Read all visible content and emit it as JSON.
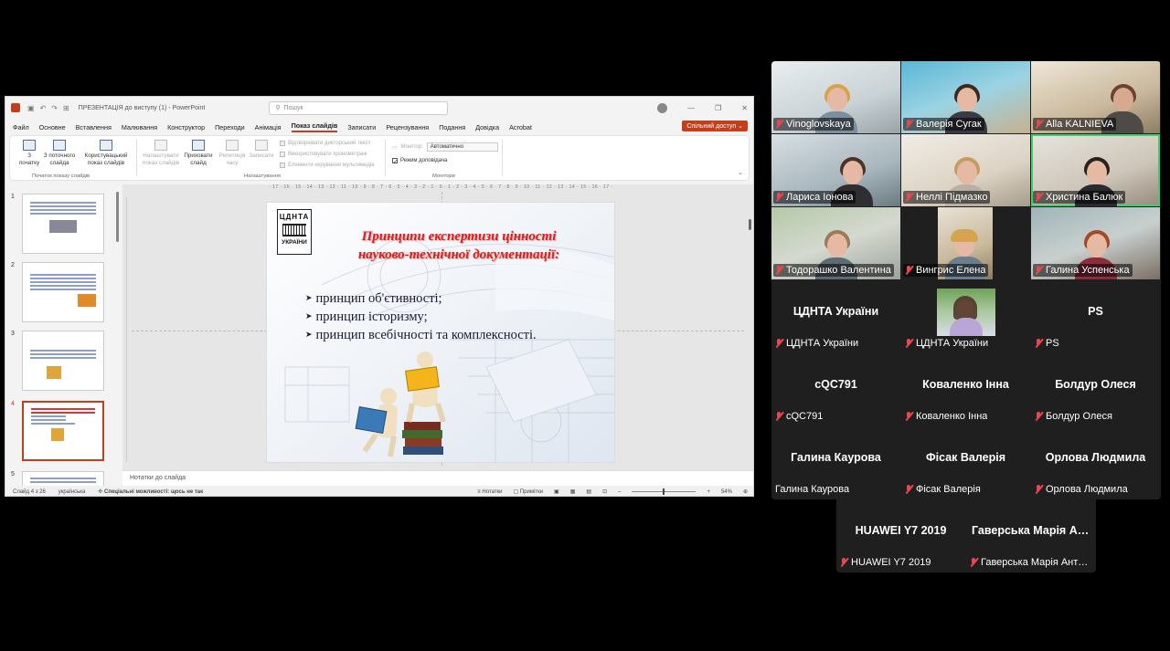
{
  "ppt": {
    "doc_title": "ПРЕЗЕНТАЦІЯ до виступу (1)  -  PowerPoint",
    "search_placeholder": "Пошук",
    "tabs": [
      "Файл",
      "Основне",
      "Вставлення",
      "Малювання",
      "Конструктор",
      "Переходи",
      "Анімація",
      "Показ слайдів",
      "Записати",
      "Рецензування",
      "Подання",
      "Довідка",
      "Acrobat"
    ],
    "active_tab": "Показ слайдів",
    "share_label": "Спільний доступ",
    "ribbon": {
      "btn_from_start": "З\nпочатку",
      "btn_from_current": "З поточного\nслайда",
      "btn_custom": "Користувацький\nпоказ слайдів",
      "group_start": "Початок показу слайдів",
      "btn_setup": "Налаштувати\nпоказ слайдів",
      "btn_hide": "Приховати\nслайд",
      "btn_rehearse": "Репетиція\nчасу",
      "btn_record": "Записати",
      "chk_narration": "Відтворювати дикторський текст",
      "chk_timings": "Використовувати хронометраж",
      "chk_media": "Елементи керування мультимедіа",
      "group_setup": "Налаштування",
      "monitor_label": "Монітор:",
      "monitor_value": "Автоматично",
      "presenter_view": "Режим доповідача",
      "group_monitors": "Монітори"
    },
    "thumb_numbers": [
      "1",
      "2",
      "3",
      "4",
      "5"
    ],
    "selected_slide": 4,
    "ruler": "· 17 · 16 · 15 · 14 · 13 · 12 · 11 · 10 · 9 · 8 · 7 · 6 · 5 · 4 · 3 · 2 · 1 · 0 · 1 · 2 · 3 · 4 · 5 · 6 · 7 · 8 · 9 · 10 · 11 · 12 · 13 · 14 · 15 · 16 · 17 ·",
    "slide": {
      "logo_top": "ЦДНТА",
      "logo_bottom": "УКРАЇНИ",
      "title_line1": "Принципи експертизи цінності",
      "title_line2": "науково-технічної документації:",
      "bullets": [
        "принцип об'єтивності;",
        "принцип історизму;",
        "принцип всебічності та комплексності."
      ]
    },
    "notes_placeholder": "Нотатки до слайда",
    "status": {
      "slide_counter": "Слайд 4 з 26",
      "language": "українська",
      "accessibility": "Спеціальні можливості: щось не так",
      "notes_btn": "Нотатки",
      "comments_btn": "Примітки",
      "zoom": "54%"
    }
  },
  "participants": [
    {
      "name": "Vinoglovskaya",
      "video": true
    },
    {
      "name": "Валерія Сугак",
      "video": true
    },
    {
      "name": "Alla KALNIEVA",
      "video": true
    },
    {
      "name": "Лариса Іонова",
      "video": true
    },
    {
      "name": "Неллі Підмазко",
      "video": true
    },
    {
      "name": "Христина Балюк",
      "video": true,
      "speaking": true
    },
    {
      "name": "Тодорашко Валентина",
      "video": true
    },
    {
      "name": "Вингрис Елена",
      "video": true
    },
    {
      "name": "Галина Успенська",
      "video": true
    },
    {
      "name": "ЦДНТА України",
      "display": "ЦДНТА України",
      "video": false
    },
    {
      "name": "ЦДНТА України",
      "video": false,
      "photo": true
    },
    {
      "name": "PS",
      "display": "PS",
      "video": false
    },
    {
      "name": "cQC791",
      "display": "cQC791",
      "video": false
    },
    {
      "name": "Коваленко Інна",
      "display": "Коваленко Інна",
      "video": false
    },
    {
      "name": "Болдур Олеся",
      "display": "Болдур Олеся",
      "video": false
    },
    {
      "name": "Галина Каурова",
      "display": "Галина Каурова",
      "video": false,
      "muted": false
    },
    {
      "name": "Фісак Валерія",
      "display": "Фісак Валерія",
      "video": false
    },
    {
      "name": "Орлова Людмила",
      "display": "Орлова  Людмила",
      "video": false
    },
    {
      "name": "HUAWEI Y7 2019",
      "display": "HUAWEI Y7 2019",
      "video": false
    },
    {
      "name": "Гаверська Марія Антонівна",
      "display": "Гаверська  Марія Антонівна",
      "video": false
    }
  ],
  "colors": {
    "accent": "#c43e1c",
    "speaking_border": "#3ccf6a",
    "muted_icon": "#e5484d",
    "slide_title": "#d81e1e"
  }
}
